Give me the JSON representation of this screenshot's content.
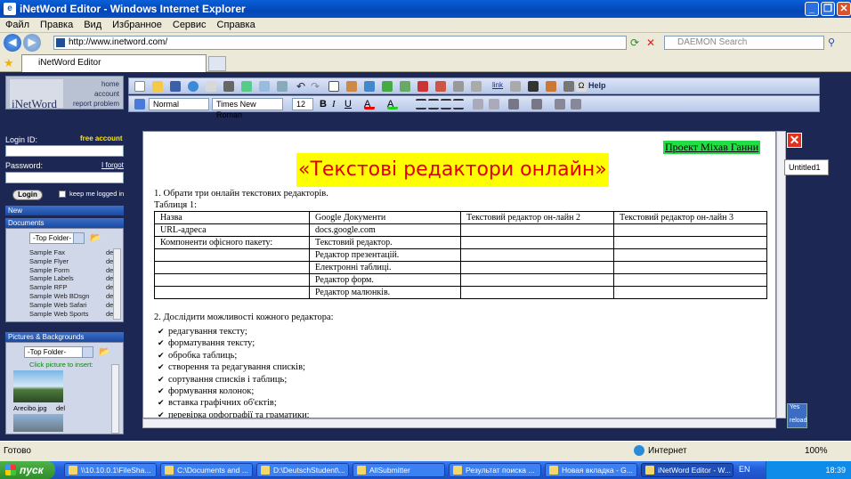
{
  "window": {
    "title": "iNetWord Editor - Windows Internet Explorer"
  },
  "menu": [
    "Файл",
    "Правка",
    "Вид",
    "Избранное",
    "Сервис",
    "Справка"
  ],
  "address": {
    "url": "http://www.inetword.com/",
    "search_placeholder": "DAEMON Search"
  },
  "tab": {
    "label": "iNetWord Editor"
  },
  "logo": {
    "text": "iNetWord",
    "links": [
      "home",
      "account",
      "report problem"
    ]
  },
  "login": {
    "login_label": "Login ID:",
    "free_account": "free account",
    "password_label": "Password:",
    "forgot": "I forgot",
    "login_button": "Login",
    "keep_logged": "keep me logged in"
  },
  "sections": {
    "new": "New",
    "documents": "Documents",
    "pictures": "Pictures & Backgrounds",
    "top_folder": "-Top Folder-",
    "click_insert": "Click picture to insert:",
    "picture_name": "Arecibo.jpg",
    "picture_del": "del"
  },
  "documents": [
    {
      "name": "Sample Fax",
      "action": "del"
    },
    {
      "name": "Sample Flyer",
      "action": "del"
    },
    {
      "name": "Sample Form",
      "action": "del"
    },
    {
      "name": "Sample Labels",
      "action": "del"
    },
    {
      "name": "Sample RFP",
      "action": "del"
    },
    {
      "name": "Sample Web BDsgn",
      "action": "del"
    },
    {
      "name": "Sample Web Safari",
      "action": "del"
    },
    {
      "name": "Sample Web Sports",
      "action": "del"
    }
  ],
  "toolbar": {
    "style": "Normal",
    "font": "Times New Roman",
    "size": "12",
    "help": "Help"
  },
  "doc": {
    "project_link": "Проект Міхав Ганни",
    "heading": "«Текстові редактори онлайн»",
    "task1": "1. Обрати три онлайн текстових редакторів.",
    "table_caption": "Таблиця 1:",
    "table": [
      [
        "Назва",
        "Google Документи",
        "Текстовий редактор он-лайн 2",
        "Текстовий редактор он-лайн 3"
      ],
      [
        "URL-адреса",
        "docs.google.com",
        "",
        ""
      ],
      [
        "Компоненти офісного пакету:",
        "Текстовий редактор.",
        "",
        ""
      ],
      [
        "",
        "Редактор презентацій.",
        "",
        ""
      ],
      [
        "",
        "Електронні таблиці.",
        "",
        ""
      ],
      [
        "",
        "Редактор форм.",
        "",
        ""
      ],
      [
        "",
        "Редактор малюнків.",
        "",
        ""
      ]
    ],
    "task2": "2. Дослідити можливості кожного редактора:",
    "bullets": [
      "редагування тексту;",
      "форматування тексту;",
      "обробка таблиць;",
      "створення та редагування списків;",
      "сортування списків і таблиць;",
      "формування колонок;",
      "вставка графічних об'єктів;",
      "перевірка орфографії та граматики;"
    ]
  },
  "side": {
    "untitled": "Untitled1",
    "yes": "Yes",
    "reload": "reload"
  },
  "status": {
    "left": "Готово",
    "zone": "Интернет",
    "zoom": "100%"
  },
  "taskbar": {
    "start": "пуск",
    "tasks": [
      "\\\\10.10.0.1\\FileSha...",
      "C:\\Documents and ...",
      "D:\\DeutschStudent\\...",
      "AllSubmitter",
      "Результат поиска ...",
      "Новая вкладка - G...",
      "iNetWord Editor - W..."
    ],
    "lang": "EN",
    "clock": "18:39"
  },
  "colors": {
    "page_bg": "#1c2754",
    "heading_bg": "#ffff00",
    "heading_fg": "#e00000",
    "project_bg": "#22dd44"
  }
}
